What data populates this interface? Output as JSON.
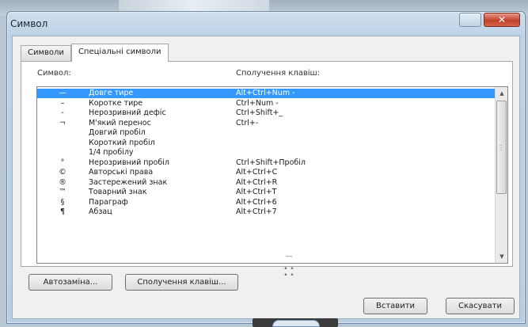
{
  "window": {
    "title": "Символ",
    "close_glyph": "✕"
  },
  "tabs": [
    {
      "label": "Символи"
    },
    {
      "label": "Спеціальні символи"
    }
  ],
  "columns": {
    "symbol": "Символ:",
    "shortcut": "Сполучення клавіш:"
  },
  "rows": [
    {
      "sym": "—",
      "name": "Довге тире",
      "keys": "Alt+Ctrl+Num -",
      "selected": true
    },
    {
      "sym": "–",
      "name": "Коротке тире",
      "keys": "Ctrl+Num -"
    },
    {
      "sym": "-",
      "name": "Нерозривний дефіс",
      "keys": "Ctrl+Shift+_"
    },
    {
      "sym": "¬",
      "name": "М'який перенос",
      "keys": "Ctrl+-"
    },
    {
      "sym": "",
      "name": "Довгий пробіл",
      "keys": ""
    },
    {
      "sym": "",
      "name": "Короткий пробіл",
      "keys": ""
    },
    {
      "sym": "",
      "name": "1/4 пробілу",
      "keys": ""
    },
    {
      "sym": "°",
      "name": "Нерозривний пробіл",
      "keys": "Ctrl+Shift+Пробіл"
    },
    {
      "sym": "©",
      "name": "Авторські права",
      "keys": "Alt+Ctrl+C"
    },
    {
      "sym": "®",
      "name": "Застережений знак",
      "keys": "Alt+Ctrl+R"
    },
    {
      "sym": "™",
      "name": "Товарний знак",
      "keys": "Alt+Ctrl+T"
    },
    {
      "sym": "§",
      "name": "Параграф",
      "keys": "Alt+Ctrl+6"
    },
    {
      "sym": "¶",
      "name": "Абзац",
      "keys": "Alt+Ctrl+7"
    }
  ],
  "buttons": {
    "autocorrect": "Автозаміна...",
    "shortcut_keys": "Сполучення клавіш...",
    "insert": "Вставити",
    "cancel": "Скасувати"
  },
  "colors": {
    "selection": "#3399ff",
    "close_button": "#c3402c"
  }
}
